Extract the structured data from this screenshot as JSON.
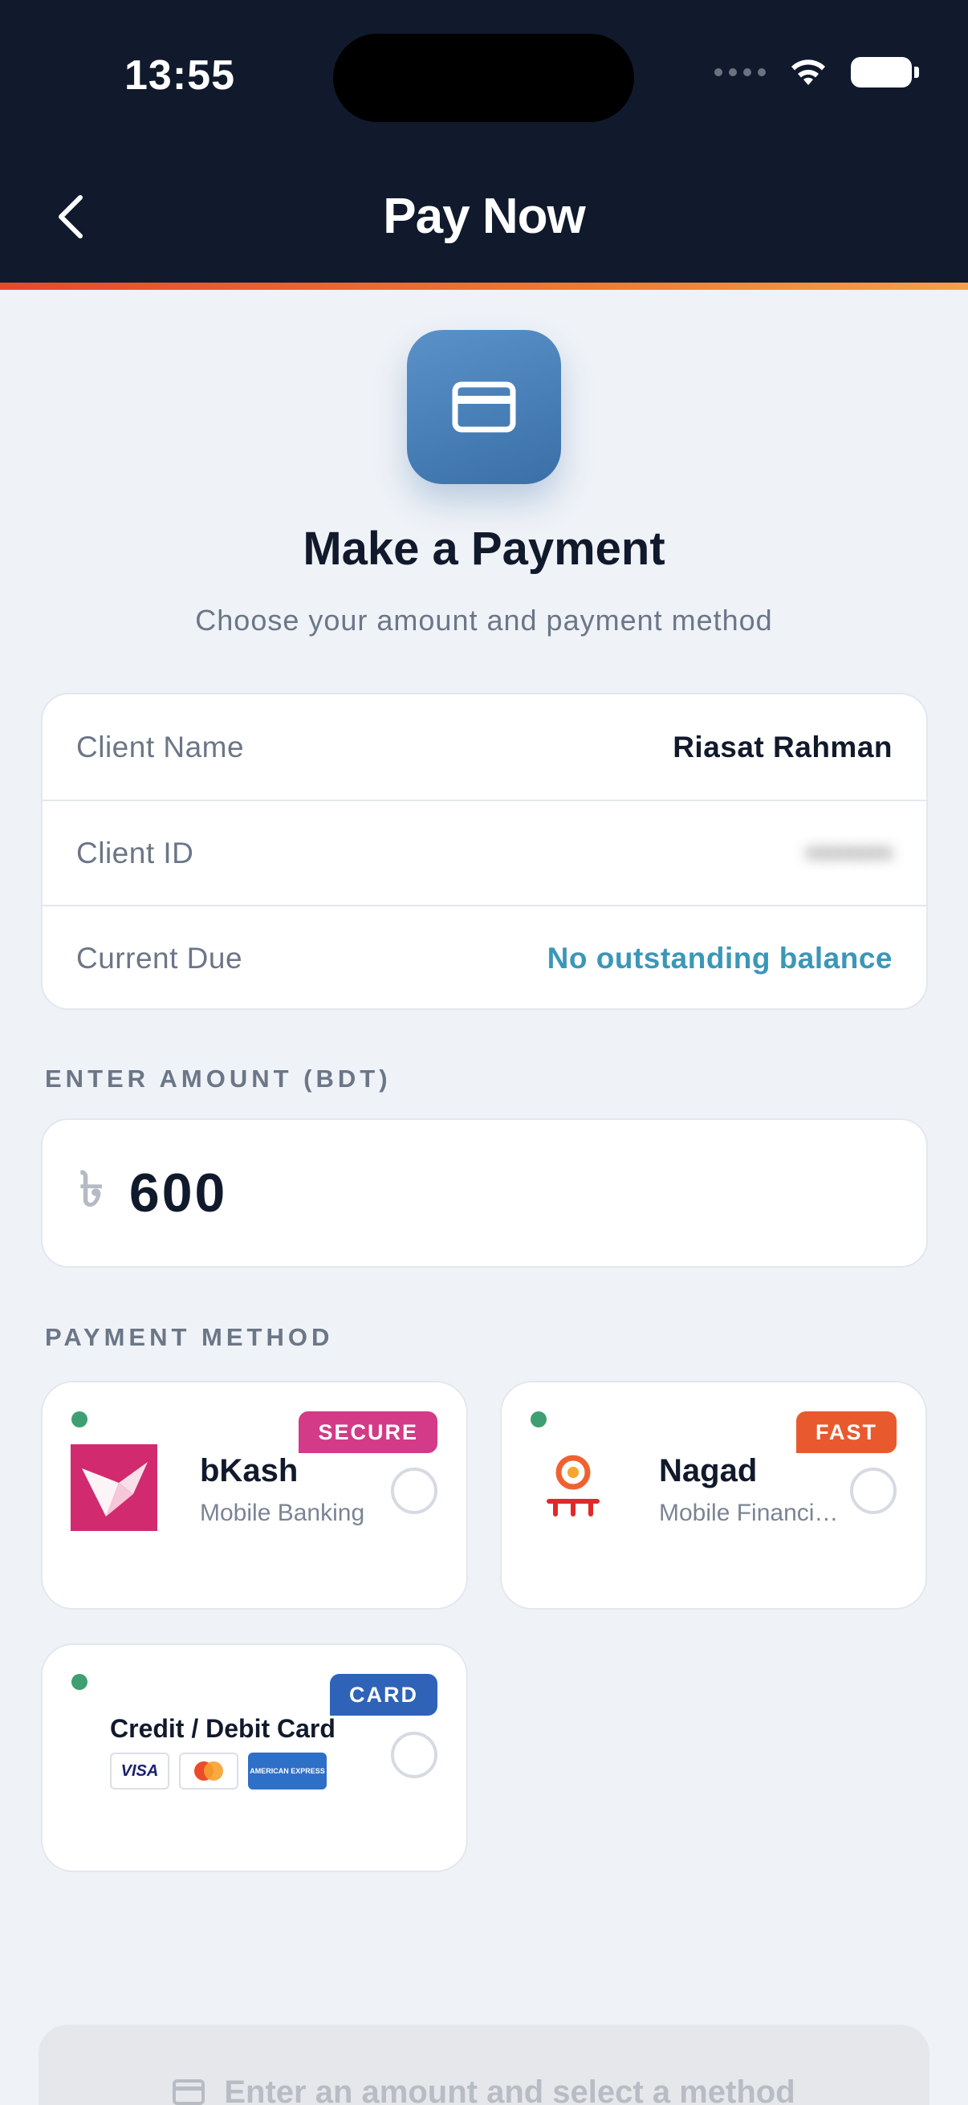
{
  "status_bar": {
    "time": "13:55"
  },
  "header": {
    "title": "Pay Now"
  },
  "hero": {
    "title": "Make a Payment",
    "subtitle": "Choose your amount and payment method"
  },
  "client_info": [
    {
      "label": "Client Name",
      "value": "Riasat Rahman"
    },
    {
      "label": "Client ID",
      "value": "••••••••"
    },
    {
      "label": "Current Due",
      "value": "No outstanding balance"
    }
  ],
  "amount": {
    "section_label": "ENTER AMOUNT (BDT)",
    "currency_symbol": "৳",
    "value": "600"
  },
  "payment_method": {
    "section_label": "PAYMENT METHOD",
    "methods": [
      {
        "name": "bKash",
        "description": "Mobile Banking",
        "badge": "SECURE",
        "badge_color": "#d33a87",
        "logo_color": "#d12a6e"
      },
      {
        "name": "Nagad",
        "description": "Mobile Financial Service",
        "badge": "FAST",
        "badge_color": "#e85a2e",
        "logo_color": "#e53a2d"
      },
      {
        "name": "Credit / Debit Card",
        "badge": "CARD",
        "badge_color": "#2e63b8",
        "brands": [
          "VISA",
          "MC",
          "AMERICAN EXPRESS"
        ]
      }
    ]
  },
  "pay_button": {
    "label": "Enter an amount and select a method"
  },
  "colors": {
    "header_bg": "#101a2c",
    "accent_blue": "#3b97b8",
    "available_dot": "#3f9f72"
  }
}
